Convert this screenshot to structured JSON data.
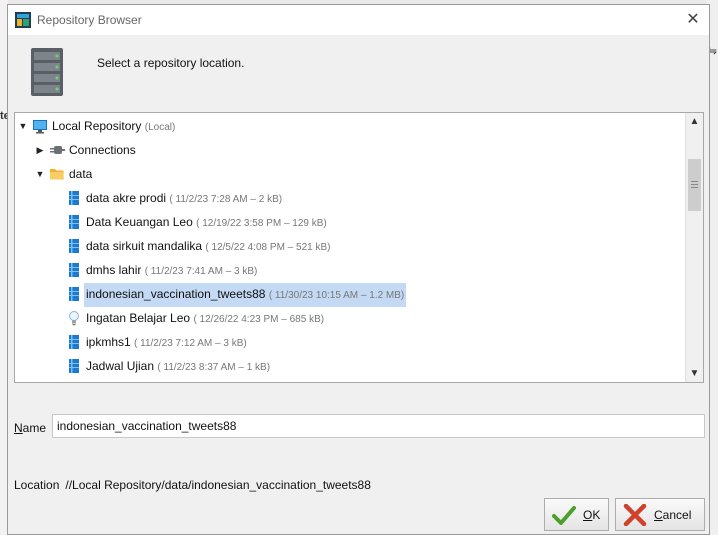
{
  "window": {
    "title": "Repository Browser",
    "close_symbol": "✕"
  },
  "header": {
    "prompt": "Select a repository location."
  },
  "tree": {
    "root": {
      "label": "Local Repository",
      "meta": "(Local)"
    },
    "connections": {
      "label": "Connections"
    },
    "data_folder": {
      "label": "data"
    },
    "items": [
      {
        "label": "data akre prodi",
        "meta": "( 11/2/23 7:28 AM – 2 kB)",
        "icon": "data-table-icon"
      },
      {
        "label": "Data Keuangan Leo",
        "meta": "( 12/19/22 3:58 PM – 129 kB)",
        "icon": "data-table-icon"
      },
      {
        "label": "data sirkuit mandalika",
        "meta": "( 12/5/22 4:08 PM – 521 kB)",
        "icon": "data-table-icon"
      },
      {
        "label": "dmhs lahir",
        "meta": "( 11/2/23 7:41 AM – 3 kB)",
        "icon": "data-table-icon"
      },
      {
        "label": "indonesian_vaccination_tweets88",
        "meta": "( 11/30/23 10:15 AM – 1.2 MB)",
        "icon": "data-table-icon",
        "selected": true
      },
      {
        "label": "Ingatan Belajar Leo",
        "meta": "( 12/26/22 4:23 PM – 685 kB)",
        "icon": "lightbulb-icon"
      },
      {
        "label": "ipkmhs1",
        "meta": "( 11/2/23 7:12 AM – 3 kB)",
        "icon": "data-table-icon"
      },
      {
        "label": "Jadwal Ujian",
        "meta": "( 11/2/23 8:37 AM – 1 kB)",
        "icon": "data-table-icon"
      }
    ]
  },
  "name_field": {
    "label_first": "N",
    "label_rest": "ame",
    "value": "indonesian_vaccination_tweets88"
  },
  "location": {
    "label": "Location",
    "value": "//Local Repository/data/indonesian_vaccination_tweets88"
  },
  "buttons": {
    "ok_first": "O",
    "ok_rest": "K",
    "cancel_first": "C",
    "cancel_rest": "ancel"
  },
  "background": {
    "left_mark": "te",
    "right_mark": "⇋"
  },
  "colors": {
    "selection": "#c3d9f4",
    "data_icon": "#1c7bd0",
    "ok_check": "#4aa02c",
    "cancel_x": "#d0402a"
  }
}
